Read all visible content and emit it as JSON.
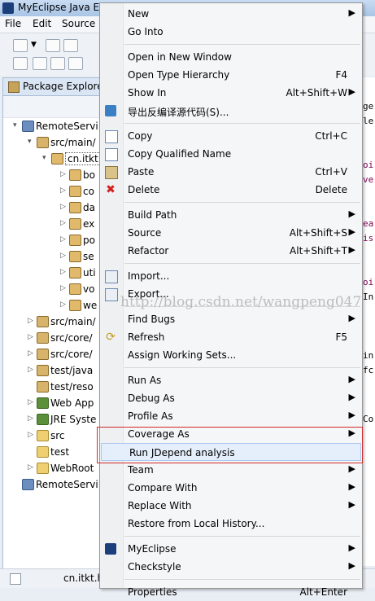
{
  "window": {
    "title": "MyEclipse Java En"
  },
  "menubar": {
    "items": [
      "File",
      "Edit",
      "Source"
    ]
  },
  "package_explorer": {
    "tab_label": "Package Explore",
    "tree": [
      {
        "label": "RemoteServi",
        "level": 0,
        "twisty": "▾",
        "icon": "proj"
      },
      {
        "label": "src/main/",
        "level": 1,
        "twisty": "▾",
        "icon": "src"
      },
      {
        "label": "cn.itkt.",
        "level": 2,
        "twisty": "▾",
        "icon": "pkg"
      },
      {
        "label": "bo",
        "level": 3,
        "twisty": "▷",
        "icon": "pkg"
      },
      {
        "label": "co",
        "level": 3,
        "twisty": "▷",
        "icon": "pkg"
      },
      {
        "label": "da",
        "level": 3,
        "twisty": "▷",
        "icon": "pkg"
      },
      {
        "label": "ex",
        "level": 3,
        "twisty": "▷",
        "icon": "pkg"
      },
      {
        "label": "po",
        "level": 3,
        "twisty": "▷",
        "icon": "pkg"
      },
      {
        "label": "se",
        "level": 3,
        "twisty": "▷",
        "icon": "pkg"
      },
      {
        "label": "uti",
        "level": 3,
        "twisty": "▷",
        "icon": "pkg"
      },
      {
        "label": "vo",
        "level": 3,
        "twisty": "▷",
        "icon": "pkg"
      },
      {
        "label": "we",
        "level": 3,
        "twisty": "▷",
        "icon": "pkg"
      },
      {
        "label": "src/main/",
        "level": 1,
        "twisty": "▷",
        "icon": "src"
      },
      {
        "label": "src/core/",
        "level": 1,
        "twisty": "▷",
        "icon": "src"
      },
      {
        "label": "src/core/",
        "level": 1,
        "twisty": "▷",
        "icon": "src"
      },
      {
        "label": "test/java",
        "level": 1,
        "twisty": "▷",
        "icon": "src"
      },
      {
        "label": "test/reso",
        "level": 1,
        "twisty": "",
        "icon": "src"
      },
      {
        "label": "Web App",
        "level": 1,
        "twisty": "▷",
        "icon": "lib"
      },
      {
        "label": "JRE Syste",
        "level": 1,
        "twisty": "▷",
        "icon": "lib"
      },
      {
        "label": "src",
        "level": 1,
        "twisty": "▷",
        "icon": "fold"
      },
      {
        "label": "test",
        "level": 1,
        "twisty": "",
        "icon": "fold"
      },
      {
        "label": "WebRoot",
        "level": 1,
        "twisty": "▷",
        "icon": "fold"
      },
      {
        "label": "RemoteServi",
        "level": 0,
        "twisty": "",
        "icon": "proj"
      }
    ]
  },
  "context_menu": {
    "items": [
      {
        "label": "New",
        "submenu": true
      },
      {
        "label": "Go Into"
      },
      {
        "separator": true
      },
      {
        "label": "Open in New Window"
      },
      {
        "label": "Open Type Hierarchy",
        "shortcut": "F4"
      },
      {
        "label": "Show In",
        "shortcut": "Alt+Shift+W",
        "submenu": true
      },
      {
        "label": "导出反编译源代码(S)...",
        "icon": "export-decompiled-icon"
      },
      {
        "separator": true
      },
      {
        "label": "Copy",
        "shortcut": "Ctrl+C",
        "icon": "copy-icon"
      },
      {
        "label": "Copy Qualified Name",
        "icon": "copy-qualified-icon"
      },
      {
        "label": "Paste",
        "shortcut": "Ctrl+V",
        "icon": "paste-icon"
      },
      {
        "label": "Delete",
        "shortcut": "Delete",
        "icon": "delete-icon"
      },
      {
        "separator": true
      },
      {
        "label": "Build Path",
        "submenu": true
      },
      {
        "label": "Source",
        "shortcut": "Alt+Shift+S",
        "submenu": true
      },
      {
        "label": "Refactor",
        "shortcut": "Alt+Shift+T",
        "submenu": true
      },
      {
        "separator": true
      },
      {
        "label": "Import...",
        "icon": "import-icon"
      },
      {
        "label": "Export...",
        "icon": "export-icon"
      },
      {
        "separator": true
      },
      {
        "label": "Find Bugs",
        "submenu": true
      },
      {
        "label": "Refresh",
        "shortcut": "F5",
        "icon": "refresh-icon"
      },
      {
        "label": "Assign Working Sets..."
      },
      {
        "separator": true
      },
      {
        "label": "Run As",
        "submenu": true
      },
      {
        "label": "Debug As",
        "submenu": true
      },
      {
        "label": "Profile As",
        "submenu": true
      },
      {
        "label": "Coverage As",
        "submenu": true
      },
      {
        "label": "Run JDepend analysis",
        "highlighted": true
      },
      {
        "label": "Team",
        "submenu": true
      },
      {
        "label": "Compare With",
        "submenu": true
      },
      {
        "label": "Replace With",
        "submenu": true
      },
      {
        "label": "Restore from Local History..."
      },
      {
        "separator": true
      },
      {
        "label": "MyEclipse",
        "submenu": true,
        "icon": "myeclipse-icon"
      },
      {
        "label": "Checkstyle",
        "submenu": true
      },
      {
        "separator": true
      },
      {
        "label": "Properties",
        "shortcut": "Alt+Enter"
      }
    ]
  },
  "editor_fragments": [
    "ge",
    "le",
    "oi",
    "ve",
    "ea",
    "is",
    "oi",
    "In",
    "in",
    "fc",
    "Co"
  ],
  "statusbar": {
    "text": "cn.itkt.h"
  },
  "watermark": "http://blog.csdn.net/wangpeng047",
  "colors": {
    "highlight_border": "#d12a2a",
    "menu_bg": "#f5f6f7"
  }
}
